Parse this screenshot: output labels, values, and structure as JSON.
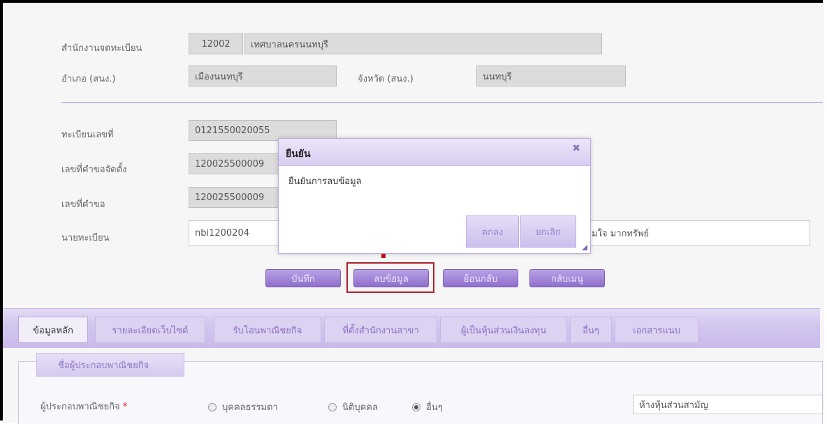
{
  "form": {
    "registry_office_label": "สำนักงานจดทะเบียน",
    "registry_office_code": "12002",
    "registry_office_name": "เทศบาลนครนนทบุรี",
    "district_label": "อำเภอ (สนง.)",
    "district_value": "เมืองนนทบุรี",
    "province_label": "จังหวัด (สนง.)",
    "province_value": "นนทบุรี",
    "reg_no_label": "ทะเบียนเลขที่",
    "reg_no_value": "0121550020055",
    "setup_req_label": "เลขที่คำขอจัดตั้ง",
    "setup_req_value": "120025500009",
    "req_no_label": "เลขที่คำขอ",
    "req_no_value": "120025500009",
    "registrar_label": "นายทะเบียน",
    "registrar_value": "nbi1200204",
    "registrar_name_value": "มใจ   มากทรัพย์"
  },
  "actions": {
    "save": "บันทึก",
    "delete": "ลบข้อมูล",
    "back": "ย้อนกลับ",
    "menu": "กลับเมนู"
  },
  "tabs": [
    {
      "label": "ข้อมูลหลัก"
    },
    {
      "label": "รายละเอียดเว็บไซต์"
    },
    {
      "label": "รับโอนพาณิชยกิจ"
    },
    {
      "label": "ที่ตั้งสำนักงานสาขา"
    },
    {
      "label": "ผู้เป็นหุ้นส่วนเงินลงทุน"
    },
    {
      "label": "อื่นๆ"
    },
    {
      "label": "เอกสารแนบ"
    }
  ],
  "section": {
    "legend": "ชื่อผู้ประกอบพาณิชยกิจ",
    "operator_label": "ผู้ประกอบพาณิชยกิจ",
    "required_mark": "*",
    "radio_person": "บุคคลธรรมดา",
    "radio_juristic": "นิติบุคคล",
    "radio_other": "อื่นๆ",
    "type_value": "ห้างหุ้นส่วนสามัญ"
  },
  "dialog": {
    "title": "ยืนยัน",
    "message": "ยืนยันการลบข้อมูล",
    "ok": "ตกลง",
    "cancel": "ยกเลิก",
    "close_glyph": "✖"
  },
  "colors": {
    "accent": "#9b7fd6",
    "highlight": "#b0202a",
    "arrow": "#c8101b"
  }
}
